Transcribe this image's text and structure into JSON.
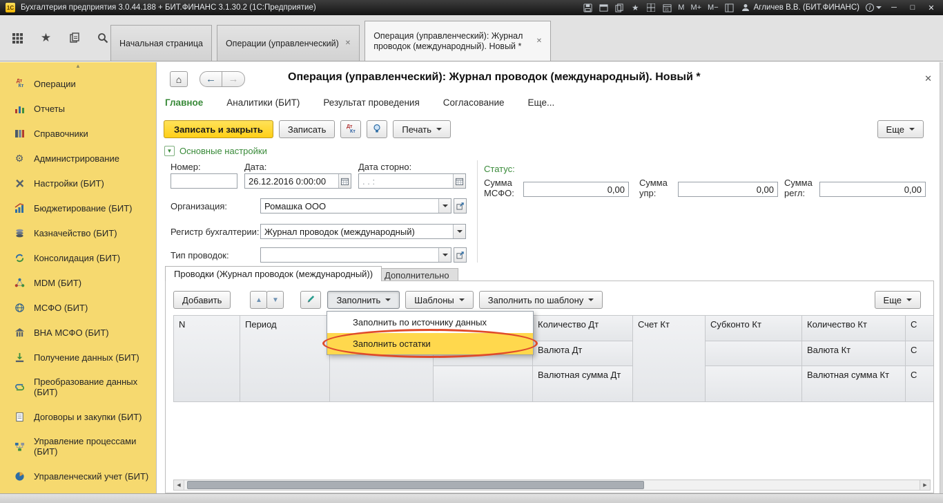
{
  "glyphs": {
    "home": "⌂",
    "back": "←",
    "forward": "→",
    "close": "✕",
    "star": "★",
    "gear": "⚙",
    "scroll_up": "▲",
    "up": "▲",
    "down": "▼",
    "left": "◀",
    "right": "▶",
    "dt": "Дт",
    "kt": "Кт",
    "info": "i"
  },
  "titlebar": {
    "title": "Бухгалтерия предприятия 3.0.44.188 + БИТ.ФИНАНС 3.1.30.2 (1С:Предприятие)",
    "memory": [
      "M",
      "M+",
      "M−"
    ],
    "user": "Агличев В.В. (БИТ.ФИНАНС)",
    "window_buttons": {
      "minimize": "─",
      "maximize": "□",
      "close": "✕"
    }
  },
  "workspace_tabs": [
    {
      "label": "Начальная страница"
    },
    {
      "label": "Операции (управленческий)"
    },
    {
      "label": "Операция (управленческий): Журнал проводок (международный). Новый *"
    }
  ],
  "sidebar": {
    "items": [
      {
        "label": "Операции"
      },
      {
        "label": "Отчеты"
      },
      {
        "label": "Справочники"
      },
      {
        "label": "Администрирование"
      },
      {
        "label": "Настройки (БИТ)"
      },
      {
        "label": "Бюджетирование (БИТ)"
      },
      {
        "label": "Казначейство (БИТ)"
      },
      {
        "label": "Консолидация (БИТ)"
      },
      {
        "label": "MDM (БИТ)"
      },
      {
        "label": "МСФО (БИТ)"
      },
      {
        "label": "ВНА МСФО (БИТ)"
      },
      {
        "label": "Получение данных (БИТ)"
      },
      {
        "label": "Преобразование данных (БИТ)"
      },
      {
        "label": "Договоры и закупки (БИТ)"
      },
      {
        "label": "Управление процессами (БИТ)"
      },
      {
        "label": "Управленческий учет (БИТ)"
      }
    ]
  },
  "form": {
    "title": "Операция (управленческий): Журнал проводок (международный). Новый *",
    "nav_tabs": [
      {
        "label": "Главное"
      },
      {
        "label": "Аналитики (БИТ)"
      },
      {
        "label": "Результат проведения"
      },
      {
        "label": "Согласование"
      },
      {
        "label": "Еще..."
      }
    ],
    "toolbar": {
      "save_and_close": "Записать и закрыть",
      "save": "Записать",
      "print": "Печать",
      "more": "Еще"
    },
    "section_title": "Основные настройки",
    "fields": {
      "number": {
        "label": "Номер:",
        "value": ""
      },
      "date": {
        "label": "Дата:",
        "value": "26.12.2016  0:00:00"
      },
      "storno_date": {
        "label": "Дата сторно:",
        "value": " .  .       :"
      },
      "status": {
        "label": "Статус:"
      },
      "sum_msfo": {
        "label": "Сумма МСФО:",
        "value": "0,00"
      },
      "sum_upr": {
        "label": "Сумма упр:",
        "value": "0,00"
      },
      "sum_regl": {
        "label": "Сумма регл:",
        "value": "0,00"
      },
      "organization": {
        "label": "Организация:",
        "value": "Ромашка ООО"
      },
      "register": {
        "label": "Регистр бухгалтерии:",
        "value": "Журнал проводок (международный)"
      },
      "entry_type": {
        "label": "Тип проводок:",
        "value": ""
      }
    }
  },
  "grid": {
    "tabs": [
      {
        "label": "Проводки (Журнал проводок (международный))"
      },
      {
        "label": "Дополнительно"
      }
    ],
    "toolbar": {
      "add": "Добавить",
      "fill": "Заполнить",
      "templates": "Шаблоны",
      "fill_by_template": "Заполнить по шаблону",
      "more": "Еще"
    },
    "menu": {
      "items": [
        {
          "label": "Заполнить по источнику данных"
        },
        {
          "label": "Заполнить остатки"
        }
      ]
    },
    "columns": {
      "n": "N",
      "period": "Период",
      "qty_dt": "Количество Дт",
      "cur_dt": "Валюта Дт",
      "cur_sum_dt": "Валютная сумма Дт",
      "account_kt": "Счет Кт",
      "subconto_kt": "Субконто Кт",
      "qty_kt": "Количество Кт",
      "cur_kt": "Валюта Кт",
      "cur_sum_kt": "Валютная сумма Кт",
      "truncated": "С"
    }
  },
  "icons": {
    "operations-icon": "ДтКт",
    "reports-icon": "bar-chart",
    "references-icon": "books",
    "administration-icon": "gear",
    "bit-settings-icon": "tools",
    "budgeting-icon": "chart-arrow",
    "treasury-icon": "coins",
    "consolidation-icon": "cycle",
    "mdm-icon": "nodes",
    "msfo-icon": "globe",
    "vna-msfo-icon": "building",
    "data-receiving-icon": "download",
    "data-transformation-icon": "transform",
    "contracts-icon": "document",
    "process-management-icon": "flowchart",
    "management-accounting-icon": "pie-chart",
    "menu-grid-icon": "grid",
    "favorites-icon": "star",
    "history-icon": "pages",
    "search-icon": "magnifier",
    "calendar-button-icon": "calendar",
    "dropdown-icon": "caret",
    "open-icon": "open-square",
    "lightbulb-icon": "bulb",
    "dtkt-icon": "ДтКт",
    "pencil-icon": "pencil",
    "home-icon": "house"
  }
}
